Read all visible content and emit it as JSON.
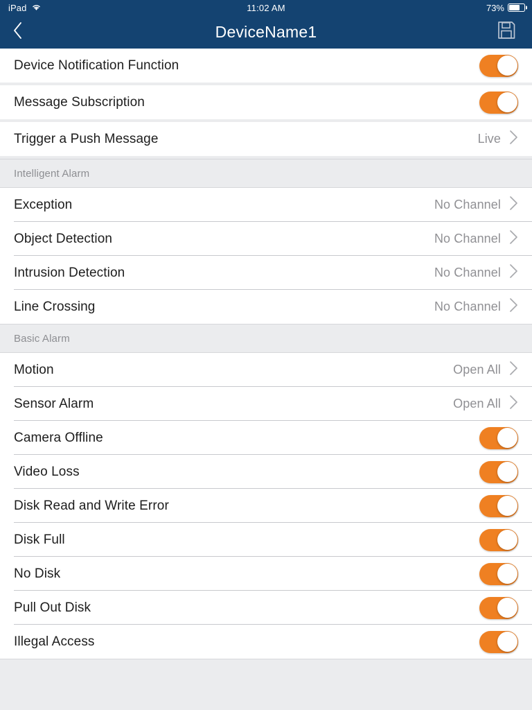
{
  "status_bar": {
    "carrier": "iPad",
    "wifi_icon": "wifi-icon",
    "time": "11:02 AM",
    "battery_percent": "73%",
    "battery_level": 73
  },
  "nav_bar": {
    "back_icon": "chevron-left-icon",
    "title": "DeviceName1",
    "save_icon": "floppy-disk-save-icon"
  },
  "colors": {
    "nav_background": "#144371",
    "accent_orange": "#ef8022",
    "page_background": "#ebecee",
    "row_background": "#ffffff",
    "separator": "#c8c9cd",
    "label_text": "#1d1d1d",
    "value_text": "#909094",
    "section_header_text": "#8d8e92"
  },
  "groups": [
    {
      "id": "device-notification-group",
      "rows": [
        {
          "id": "device-notification-function",
          "label": "Device Notification Function",
          "control": "toggle",
          "toggle_state": "on"
        }
      ]
    },
    {
      "id": "message-subscription-group",
      "rows": [
        {
          "id": "message-subscription",
          "label": "Message Subscription",
          "control": "toggle",
          "toggle_state": "on"
        }
      ]
    },
    {
      "id": "trigger-push-group",
      "rows": [
        {
          "id": "trigger-a-push-message",
          "label": "Trigger a Push Message",
          "control": "disclosure",
          "value": "Live"
        }
      ]
    }
  ],
  "sections": [
    {
      "id": "intelligent-alarm",
      "header": "Intelligent Alarm",
      "rows": [
        {
          "id": "exception",
          "label": "Exception",
          "control": "disclosure",
          "value": "No Channel"
        },
        {
          "id": "object-detection",
          "label": "Object Detection",
          "control": "disclosure",
          "value": "No Channel"
        },
        {
          "id": "intrusion-detection",
          "label": "Intrusion Detection",
          "control": "disclosure",
          "value": "No Channel"
        },
        {
          "id": "line-crossing",
          "label": "Line Crossing",
          "control": "disclosure",
          "value": "No Channel"
        }
      ]
    },
    {
      "id": "basic-alarm",
      "header": "Basic Alarm",
      "rows": [
        {
          "id": "motion",
          "label": "Motion",
          "control": "disclosure",
          "value": "Open All"
        },
        {
          "id": "sensor-alarm",
          "label": "Sensor Alarm",
          "control": "disclosure",
          "value": "Open All"
        },
        {
          "id": "camera-offline",
          "label": "Camera Offline",
          "control": "toggle",
          "toggle_state": "on"
        },
        {
          "id": "video-loss",
          "label": "Video Loss",
          "control": "toggle",
          "toggle_state": "on"
        },
        {
          "id": "disk-read-and-write-error",
          "label": "Disk Read and Write Error",
          "control": "toggle",
          "toggle_state": "on"
        },
        {
          "id": "disk-full",
          "label": "Disk Full",
          "control": "toggle",
          "toggle_state": "on"
        },
        {
          "id": "no-disk",
          "label": "No Disk",
          "control": "toggle",
          "toggle_state": "on"
        },
        {
          "id": "pull-out-disk",
          "label": "Pull Out Disk",
          "control": "toggle",
          "toggle_state": "on"
        },
        {
          "id": "illegal-access",
          "label": "Illegal Access",
          "control": "toggle",
          "toggle_state": "on"
        }
      ]
    }
  ]
}
